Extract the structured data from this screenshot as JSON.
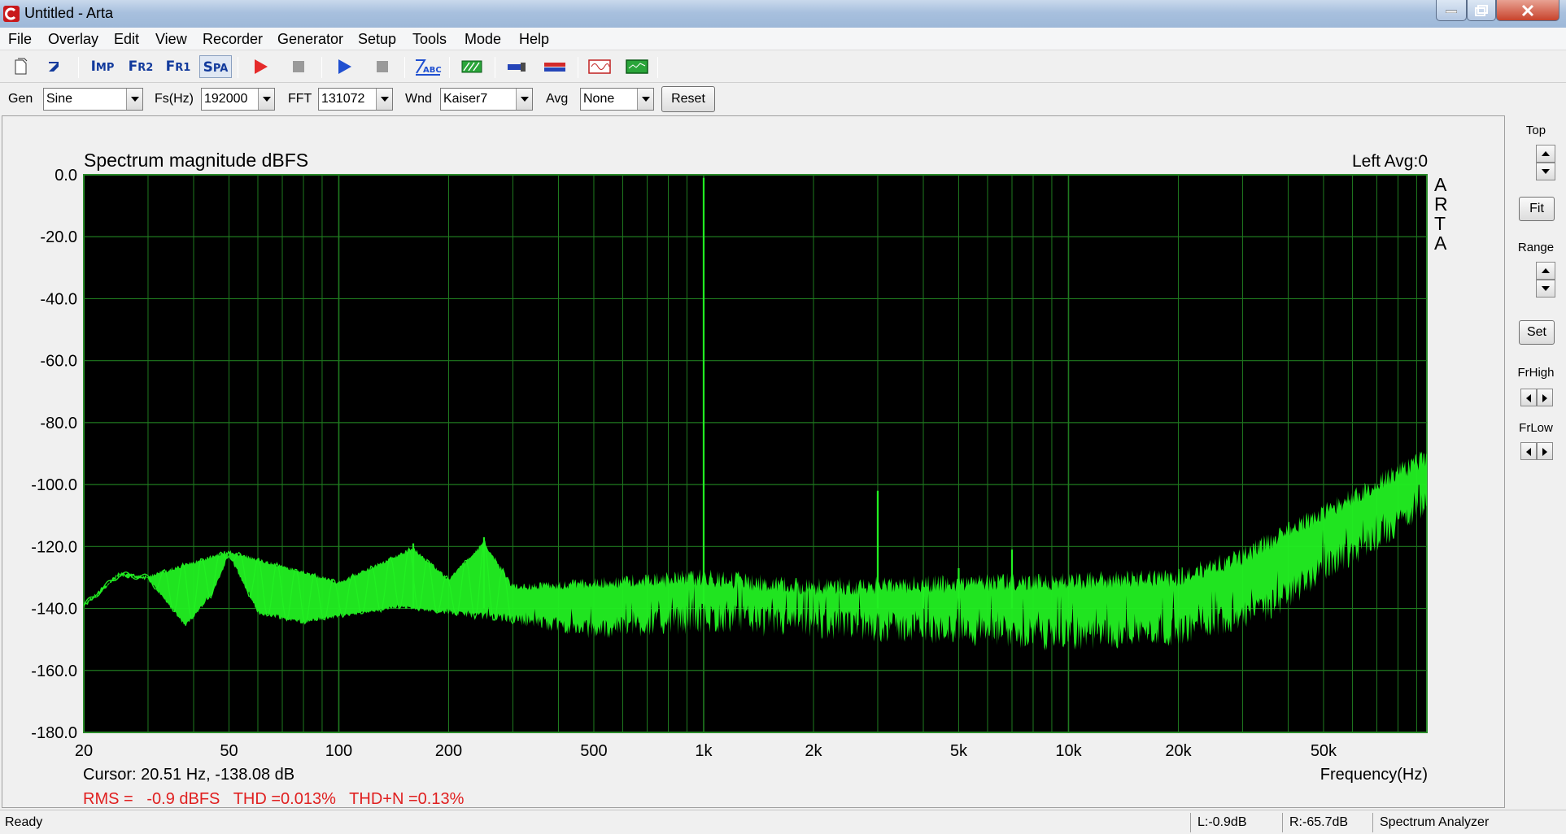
{
  "window": {
    "title": "Untitled - Arta"
  },
  "menu": [
    "File",
    "Overlay",
    "Edit",
    "View",
    "Recorder",
    "Generator",
    "Setup",
    "Tools",
    "Mode",
    "Help"
  ],
  "toolbar": {
    "buttons": [
      {
        "name": "new-file-icon"
      },
      {
        "name": "open-file-icon"
      },
      {
        "name": "impulse-mode-button",
        "label_a": "I",
        "label_b": "MP"
      },
      {
        "name": "fr2-mode-button",
        "label_a": "F",
        "label_b": "R2"
      },
      {
        "name": "fr1-mode-button",
        "label_a": "F",
        "label_b": "R1"
      },
      {
        "name": "spa-mode-button",
        "label_a": "S",
        "label_b": "PA",
        "active": true
      },
      {
        "name": "record-icon"
      },
      {
        "name": "stop-record-icon"
      },
      {
        "name": "play-icon"
      },
      {
        "name": "stop-play-icon"
      },
      {
        "name": "abc-icon"
      },
      {
        "name": "calibration-icon"
      },
      {
        "name": "probe-icon"
      },
      {
        "name": "level-icon"
      },
      {
        "name": "generator-icon"
      },
      {
        "name": "scope-icon"
      }
    ]
  },
  "params": {
    "gen_label": "Gen",
    "gen_value": "Sine",
    "fs_label": "Fs(Hz)",
    "fs_value": "192000",
    "fft_label": "FFT",
    "fft_value": "131072",
    "wnd_label": "Wnd",
    "wnd_value": "Kaiser7",
    "avg_label": "Avg",
    "avg_value": "None",
    "reset_label": "Reset"
  },
  "graph": {
    "title": "Spectrum magnitude dBFS",
    "channel_info": "Left  Avg:0",
    "logo": [
      "A",
      "R",
      "T",
      "A"
    ],
    "cursor": "Cursor: 20.51 Hz, -138.08 dB",
    "rms": "RMS =   -0.9 dBFS   THD =0.013%   THD+N =0.13%",
    "xlabel": "Frequency(Hz)",
    "background": "#000000",
    "grid_color": "#1f7a1f",
    "trace_color": "#22f022",
    "text_red": "#e02020"
  },
  "right_panel": {
    "top_label": "Top",
    "fit_label": "Fit",
    "range_label": "Range",
    "set_label": "Set",
    "frhigh_label": "FrHigh",
    "frlow_label": "FrLow"
  },
  "status": {
    "ready": "Ready",
    "left_level": "L:-0.9dB",
    "right_level": "R:-65.7dB",
    "mode": "Spectrum Analyzer"
  },
  "chart_data": {
    "type": "line",
    "xscale": "log",
    "xlim": [
      20,
      96000
    ],
    "ylim": [
      -180,
      0
    ],
    "yticks": [
      0,
      -20,
      -40,
      -60,
      -80,
      -100,
      -120,
      -140,
      -160,
      -180
    ],
    "ytick_labels": [
      "0.0",
      "-20.0",
      "-40.0",
      "-60.0",
      "-80.0",
      "-100.0",
      "-120.0",
      "-140.0",
      "-160.0",
      "-180.0"
    ],
    "xticks": [
      20,
      50,
      100,
      200,
      500,
      1000,
      2000,
      5000,
      10000,
      20000,
      50000
    ],
    "xtick_labels": [
      "20",
      "50",
      "100",
      "200",
      "500",
      "1k",
      "2k",
      "5k",
      "10k",
      "20k",
      "50k"
    ],
    "grid": true,
    "series": [
      {
        "envelope_floor": [
          [
            20,
            -140
          ],
          [
            25,
            -130
          ],
          [
            30,
            -131
          ],
          [
            38,
            -146
          ],
          [
            45,
            -136
          ],
          [
            50,
            -123
          ],
          [
            60,
            -142
          ],
          [
            80,
            -145
          ],
          [
            100,
            -143
          ],
          [
            150,
            -140
          ],
          [
            200,
            -142
          ],
          [
            300,
            -145
          ],
          [
            500,
            -150
          ],
          [
            1000,
            -148
          ],
          [
            2000,
            -150
          ],
          [
            5000,
            -152
          ],
          [
            10000,
            -154
          ],
          [
            20000,
            -152
          ],
          [
            35000,
            -145
          ],
          [
            50000,
            -132
          ],
          [
            96000,
            -112
          ]
        ],
        "envelope_ceiling": [
          [
            20,
            -138
          ],
          [
            25,
            -128
          ],
          [
            30,
            -129
          ],
          [
            50,
            -121
          ],
          [
            100,
            -131
          ],
          [
            160,
            -120
          ],
          [
            200,
            -130
          ],
          [
            250,
            -118
          ],
          [
            300,
            -132
          ],
          [
            500,
            -130
          ],
          [
            1000,
            -127
          ],
          [
            2000,
            -130
          ],
          [
            5000,
            -129
          ],
          [
            10000,
            -128
          ],
          [
            20000,
            -127
          ],
          [
            30000,
            -120
          ],
          [
            50000,
            -106
          ],
          [
            96000,
            -88
          ]
        ],
        "spikes": [
          [
            1000,
            -1
          ],
          [
            3000,
            -102
          ],
          [
            4000,
            -133
          ],
          [
            160,
            -119
          ],
          [
            250,
            -117
          ],
          [
            5000,
            -127
          ],
          [
            7000,
            -121
          ]
        ]
      }
    ]
  }
}
